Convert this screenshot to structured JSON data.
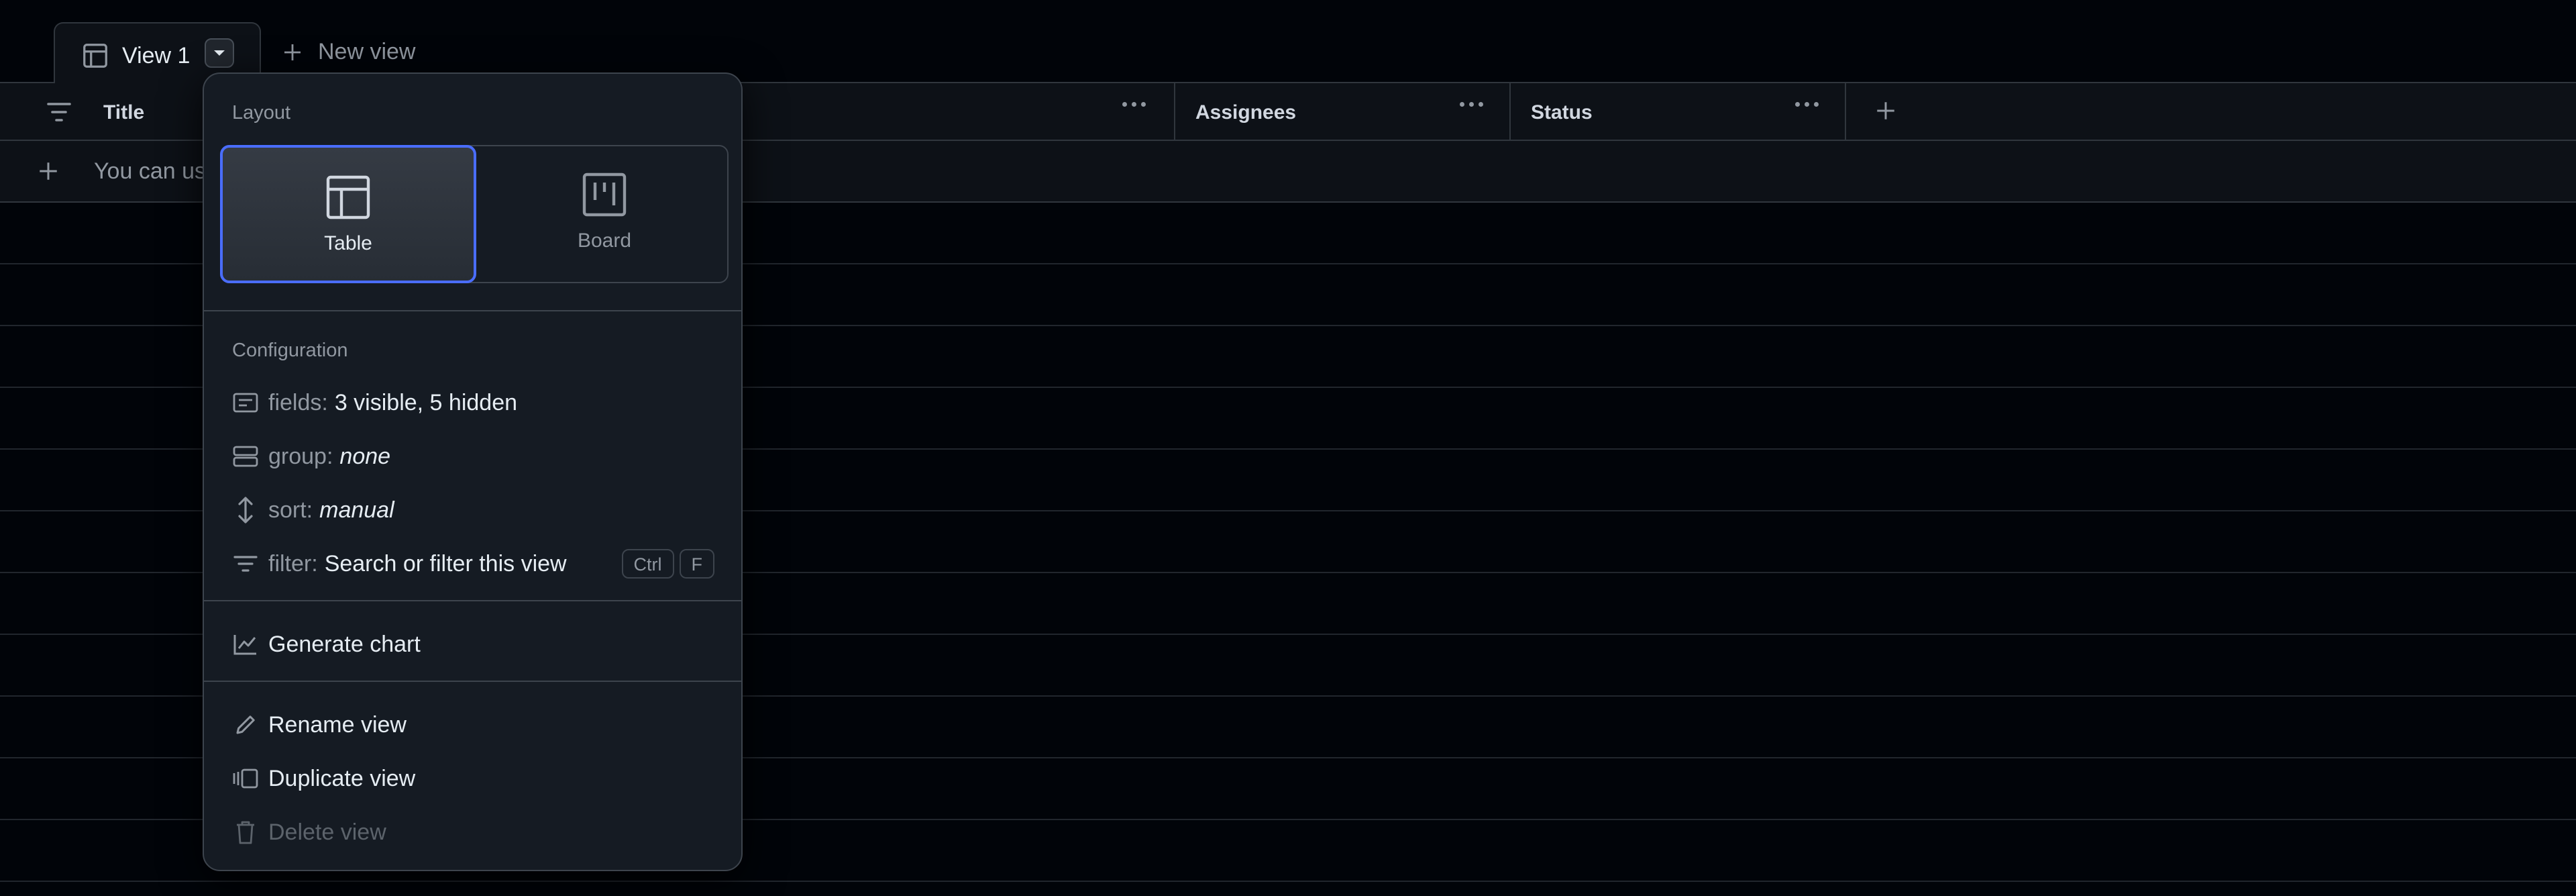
{
  "tabs": {
    "active_label": "View 1",
    "new_view_label": "New view"
  },
  "table": {
    "columns": [
      "Title",
      "Assignees",
      "Status"
    ],
    "add_item_hint": "You can us"
  },
  "menu": {
    "layout_title": "Layout",
    "layouts": [
      {
        "label": "Table",
        "selected": true
      },
      {
        "label": "Board",
        "selected": false
      }
    ],
    "configuration_title": "Configuration",
    "fields": {
      "key": "fields:",
      "value": "3 visible, 5 hidden"
    },
    "group": {
      "key": "group:",
      "value": "none"
    },
    "sort": {
      "key": "sort:",
      "value": "manual"
    },
    "filter": {
      "key": "filter:",
      "value": "Search or filter this view",
      "shortcut": [
        "Ctrl",
        "F"
      ]
    },
    "generate_chart": "Generate chart",
    "rename_view": "Rename view",
    "duplicate_view": "Duplicate view",
    "delete_view": "Delete view"
  },
  "colors": {
    "background": "#010409",
    "surface": "#0d1117",
    "menu_background": "#151b23",
    "border": "#30363d",
    "accent": "#4a6dff",
    "muted_text": "#9198a1"
  },
  "icons": [
    "table-icon",
    "chevron-down-icon",
    "plus-icon",
    "filter-icon",
    "kebab-icon",
    "board-icon",
    "fields-icon",
    "group-icon",
    "sort-icon",
    "graph-icon",
    "pencil-icon",
    "duplicate-icon",
    "trash-icon"
  ]
}
